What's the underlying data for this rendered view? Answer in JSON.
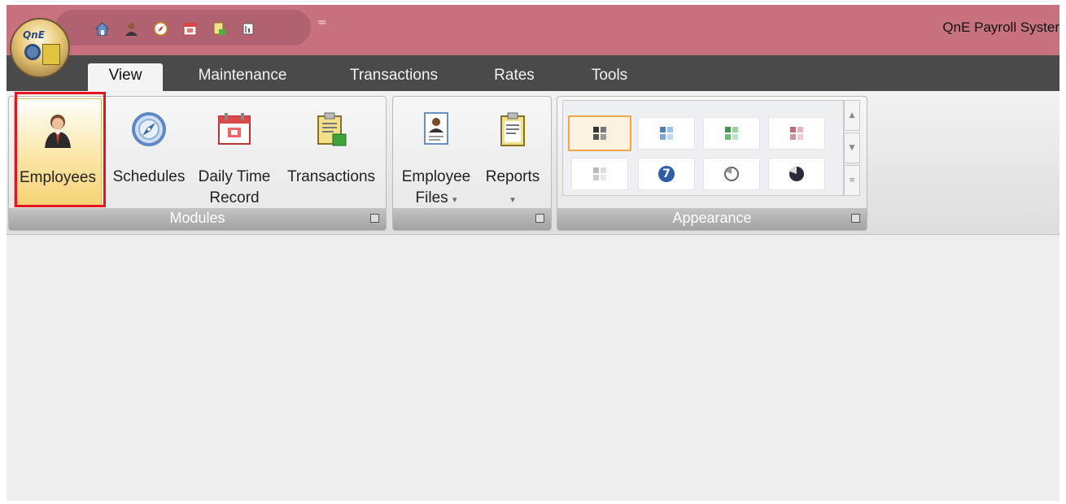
{
  "app": {
    "title": "QnE Payroll Syster",
    "orb_text": "QnE"
  },
  "quick_access": {
    "icons": [
      "home-icon",
      "user-icon",
      "compass-icon",
      "calendar-icon",
      "document-icon",
      "report-icon"
    ],
    "more_glyph": "="
  },
  "tabs": [
    {
      "label": "View",
      "active": true
    },
    {
      "label": "Maintenance"
    },
    {
      "label": "Transactions"
    },
    {
      "label": "Rates"
    },
    {
      "label": "Tools"
    }
  ],
  "groups": {
    "modules": {
      "label": "Modules",
      "buttons": [
        {
          "label": "Employees",
          "icon": "employee-icon",
          "highlighted": true
        },
        {
          "label": "Schedules",
          "icon": "compass-icon"
        },
        {
          "label": "Daily Time Record",
          "line1": "Daily Time",
          "line2": "Record",
          "icon": "calendar-icon"
        },
        {
          "label": "Transactions",
          "icon": "clipboard-icon"
        }
      ]
    },
    "files": {
      "label": "",
      "buttons": [
        {
          "label": "Employee Files",
          "line1": "Employee",
          "line2": "Files",
          "arrow": "▾",
          "icon": "employee-file-icon"
        },
        {
          "label": "Reports",
          "arrow": "▾",
          "icon": "report-clipboard-icon"
        }
      ]
    },
    "appearance": {
      "label": "Appearance",
      "gallery": [
        {
          "icon": "theme-black-icon",
          "selected": true
        },
        {
          "icon": "theme-blue-icon"
        },
        {
          "icon": "theme-green-icon"
        },
        {
          "icon": "theme-pink-icon"
        },
        {
          "icon": "theme-silver-icon"
        },
        {
          "icon": "help-icon",
          "text": "7"
        },
        {
          "icon": "undo-icon"
        },
        {
          "icon": "pie-icon"
        }
      ]
    }
  },
  "colors": {
    "titlebar": "#c8727f",
    "tabbar": "#4a4a4a",
    "highlight": "#f6d373",
    "annotation_red": "#e5141e"
  }
}
